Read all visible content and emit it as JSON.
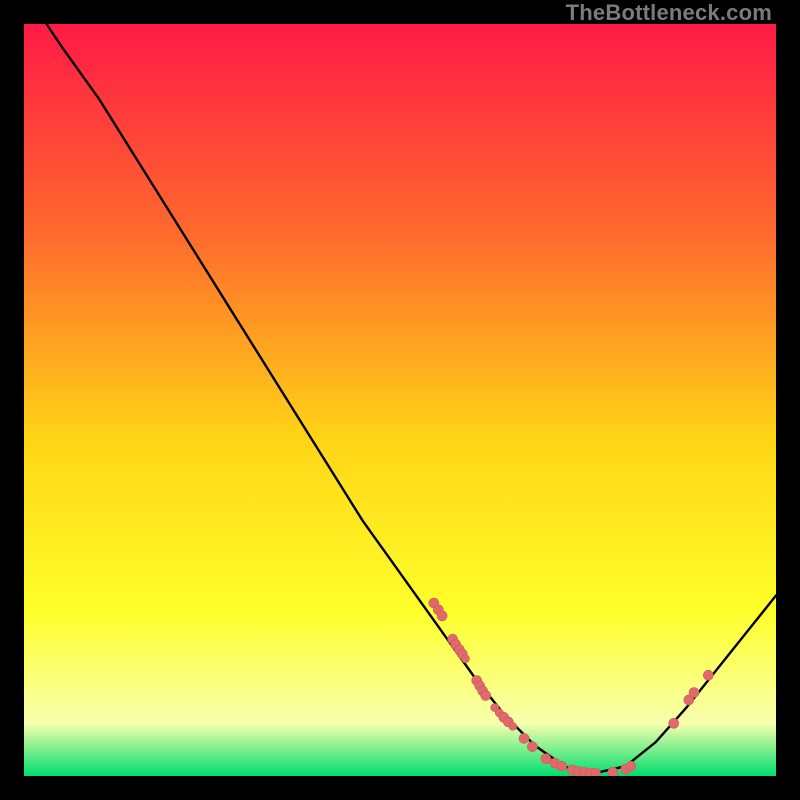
{
  "watermark": "TheBottleneck.com",
  "colors": {
    "background": "#000000",
    "gradient_top": "#ff1a46",
    "gradient_mid_upper": "#ff6a2d",
    "gradient_mid": "#ffd416",
    "gradient_mid_lower": "#ffff2a",
    "gradient_low": "#f7ffad",
    "gradient_bottom": "#00de6e",
    "curve": "#000000",
    "dot_fill": "#e06a6b",
    "dot_stroke": "#cc5a5b"
  },
  "chart_data": {
    "type": "line",
    "title": "",
    "xlabel": "",
    "ylabel": "",
    "xlim": [
      0,
      100
    ],
    "ylim": [
      0,
      100
    ],
    "curve": [
      {
        "x": 3,
        "y": 100
      },
      {
        "x": 5,
        "y": 97
      },
      {
        "x": 10,
        "y": 90
      },
      {
        "x": 15,
        "y": 82
      },
      {
        "x": 20,
        "y": 74
      },
      {
        "x": 25,
        "y": 66
      },
      {
        "x": 30,
        "y": 58
      },
      {
        "x": 35,
        "y": 50
      },
      {
        "x": 40,
        "y": 42
      },
      {
        "x": 45,
        "y": 34
      },
      {
        "x": 50,
        "y": 27
      },
      {
        "x": 55,
        "y": 20
      },
      {
        "x": 60,
        "y": 13
      },
      {
        "x": 64,
        "y": 8
      },
      {
        "x": 68,
        "y": 4
      },
      {
        "x": 72,
        "y": 1.2
      },
      {
        "x": 76,
        "y": 0.4
      },
      {
        "x": 80,
        "y": 1.3
      },
      {
        "x": 84,
        "y": 4.5
      },
      {
        "x": 88,
        "y": 9
      },
      {
        "x": 92,
        "y": 14
      },
      {
        "x": 96,
        "y": 19
      },
      {
        "x": 100,
        "y": 24
      }
    ],
    "points": [
      {
        "x": 54.5,
        "y": 23.0,
        "r": 5
      },
      {
        "x": 55.1,
        "y": 22.1,
        "r": 5
      },
      {
        "x": 55.6,
        "y": 21.3,
        "r": 5
      },
      {
        "x": 57.0,
        "y": 18.2,
        "r": 5
      },
      {
        "x": 57.4,
        "y": 17.5,
        "r": 5
      },
      {
        "x": 57.9,
        "y": 16.8,
        "r": 5
      },
      {
        "x": 58.3,
        "y": 16.2,
        "r": 5
      },
      {
        "x": 58.7,
        "y": 15.6,
        "r": 4
      },
      {
        "x": 60.2,
        "y": 12.7,
        "r": 5
      },
      {
        "x": 60.6,
        "y": 12.0,
        "r": 5
      },
      {
        "x": 61.0,
        "y": 11.3,
        "r": 5
      },
      {
        "x": 61.4,
        "y": 10.7,
        "r": 5
      },
      {
        "x": 62.6,
        "y": 9.1,
        "r": 4
      },
      {
        "x": 63.2,
        "y": 8.4,
        "r": 4
      },
      {
        "x": 63.8,
        "y": 7.8,
        "r": 5
      },
      {
        "x": 64.4,
        "y": 7.2,
        "r": 5
      },
      {
        "x": 65.0,
        "y": 6.6,
        "r": 4
      },
      {
        "x": 66.5,
        "y": 5.0,
        "r": 5
      },
      {
        "x": 67.6,
        "y": 3.9,
        "r": 5
      },
      {
        "x": 69.4,
        "y": 2.3,
        "r": 5
      },
      {
        "x": 70.6,
        "y": 1.7,
        "r": 5
      },
      {
        "x": 71.5,
        "y": 1.3,
        "r": 5
      },
      {
        "x": 72.9,
        "y": 0.8,
        "r": 5
      },
      {
        "x": 73.7,
        "y": 0.6,
        "r": 5
      },
      {
        "x": 74.5,
        "y": 0.5,
        "r": 5
      },
      {
        "x": 75.3,
        "y": 0.4,
        "r": 5
      },
      {
        "x": 76.0,
        "y": 0.4,
        "r": 5
      },
      {
        "x": 78.3,
        "y": 0.5,
        "r": 5
      },
      {
        "x": 80.0,
        "y": 0.9,
        "r": 5
      },
      {
        "x": 80.7,
        "y": 1.3,
        "r": 5
      },
      {
        "x": 86.4,
        "y": 7.0,
        "r": 5
      },
      {
        "x": 88.4,
        "y": 10.1,
        "r": 5
      },
      {
        "x": 89.1,
        "y": 11.1,
        "r": 5
      },
      {
        "x": 91.0,
        "y": 13.4,
        "r": 5
      }
    ]
  }
}
